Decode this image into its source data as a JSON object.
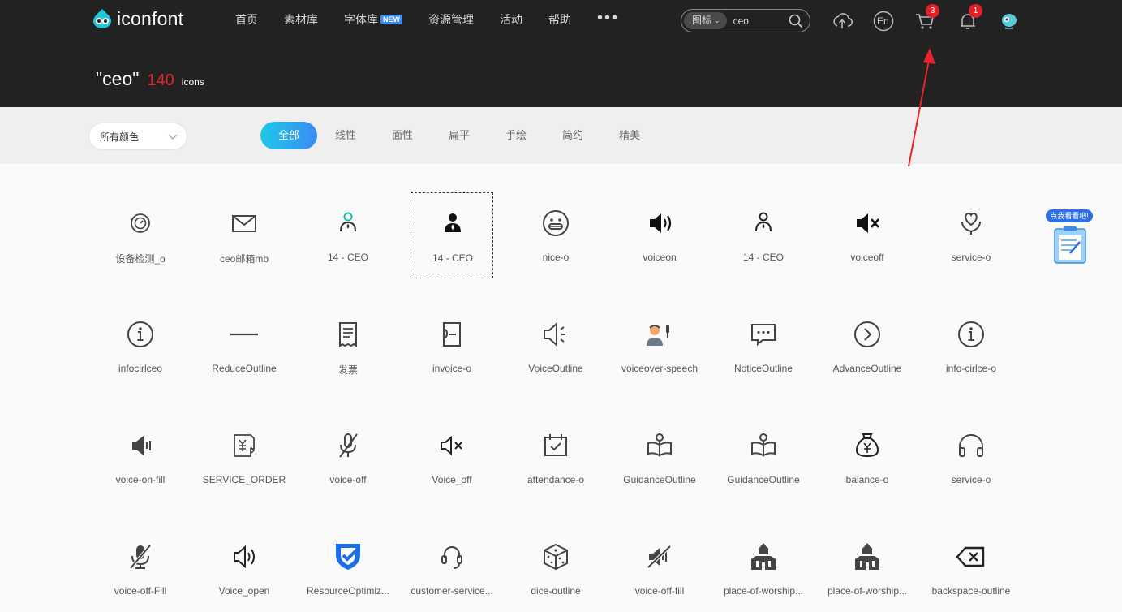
{
  "brand": {
    "name": "iconfont"
  },
  "nav": [
    {
      "label": "首页"
    },
    {
      "label": "素材库"
    },
    {
      "label": "字体库",
      "badge": "NEW"
    },
    {
      "label": "资源管理"
    },
    {
      "label": "活动"
    },
    {
      "label": "帮助"
    }
  ],
  "nav_more": "•••",
  "search": {
    "type": "图标",
    "value": "ceo"
  },
  "header_icons": {
    "cart_count": "3",
    "bell_count": "1",
    "lang": "En"
  },
  "result": {
    "query": "\"ceo\"",
    "count": "140",
    "unit": "icons"
  },
  "filter": {
    "color": "所有颜色",
    "tabs": [
      "全部",
      "线性",
      "面性",
      "扁平",
      "手绘",
      "简约",
      "精美"
    ],
    "active_tab": "全部"
  },
  "floater": {
    "tag": "点我看看吧!"
  },
  "icons": [
    {
      "label": "设备检测_o",
      "icon": "device-check-icon"
    },
    {
      "label": "ceo邮箱mb",
      "icon": "mail-icon"
    },
    {
      "label": "14 - CEO",
      "icon": "ceo-person-teal-icon"
    },
    {
      "label": "14 - CEO",
      "icon": "ceo-person-filled-icon",
      "selected": true
    },
    {
      "label": "nice-o",
      "icon": "grin-face-icon"
    },
    {
      "label": "voiceon",
      "icon": "speaker-on-icon"
    },
    {
      "label": "14 - CEO",
      "icon": "ceo-person-outline-icon"
    },
    {
      "label": "voiceoff",
      "icon": "speaker-mute-icon"
    },
    {
      "label": "service-o",
      "icon": "heart-hand-icon"
    },
    {
      "label": "infocirlceo",
      "icon": "info-circle-icon"
    },
    {
      "label": "ReduceOutline",
      "icon": "minus-line-icon"
    },
    {
      "label": "发票",
      "icon": "receipt-icon"
    },
    {
      "label": "invoice-o",
      "icon": "invoice-icon"
    },
    {
      "label": "VoiceOutline",
      "icon": "speaker-outline-icon"
    },
    {
      "label": "voiceover-speech",
      "icon": "speaker-person-icon"
    },
    {
      "label": "NoticeOutline",
      "icon": "chat-bubble-icon"
    },
    {
      "label": "AdvanceOutline",
      "icon": "chevron-circle-icon"
    },
    {
      "label": "info-cirlce-o",
      "icon": "info-circle-alt-icon"
    },
    {
      "label": "voice-on-fill",
      "icon": "speaker-fill-icon"
    },
    {
      "label": "SERVICE_ORDER",
      "icon": "service-order-icon"
    },
    {
      "label": "voice-off",
      "icon": "mic-off-icon"
    },
    {
      "label": "Voice_off",
      "icon": "speaker-x-icon"
    },
    {
      "label": "attendance-o",
      "icon": "calendar-check-icon"
    },
    {
      "label": "GuidanceOutline",
      "icon": "guidance-icon"
    },
    {
      "label": "GuidanceOutline",
      "icon": "guidance-alt-icon"
    },
    {
      "label": "balance-o",
      "icon": "money-bag-icon"
    },
    {
      "label": "service-o",
      "icon": "headphones-icon"
    },
    {
      "label": "voice-off-Fill",
      "icon": "mic-off-fill-icon"
    },
    {
      "label": "Voice_open",
      "icon": "speaker-open-icon"
    },
    {
      "label": "ResourceOptimiz...",
      "icon": "shield-check-icon"
    },
    {
      "label": "customer-service...",
      "icon": "headset-icon"
    },
    {
      "label": "dice-outline",
      "icon": "dice-icon"
    },
    {
      "label": "voice-off-fill",
      "icon": "speaker-slash-icon"
    },
    {
      "label": "place-of-worship...",
      "icon": "worship-icon"
    },
    {
      "label": "place-of-worship...",
      "icon": "worship-alt-icon"
    },
    {
      "label": "backspace-outline",
      "icon": "backspace-icon"
    }
  ],
  "colors": {
    "header_bg": "#222222",
    "accent_start": "#1ec8e6",
    "accent_end": "#3a8cf3",
    "count_red": "#e8242d",
    "teal": "#1fb8a6",
    "blue": "#1a6fe8"
  }
}
